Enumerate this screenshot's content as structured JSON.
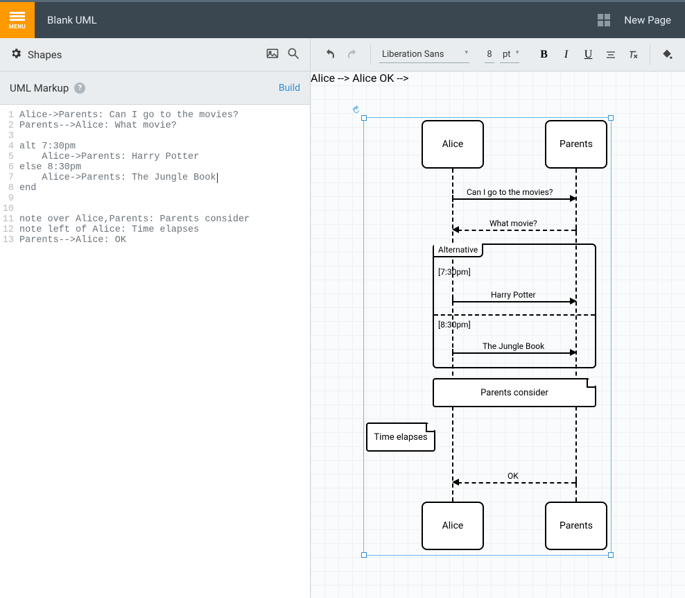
{
  "topbar": {
    "menu_label": "MENU",
    "doc_title": "Blank UML",
    "new_page": "New Page"
  },
  "toolbar": {
    "shapes_label": "Shapes",
    "font_family": "Liberation Sans",
    "font_size": "8",
    "font_unit": "pt"
  },
  "markup": {
    "title": "UML Markup",
    "build": "Build",
    "lines": [
      "Alice->Parents: Can I go to the movies?",
      "Parents-->Alice: What movie?",
      "",
      "alt 7:30pm",
      "    Alice->Parents: Harry Potter",
      "else 8:30pm",
      "    Alice->Parents: The Jungle Book",
      "end",
      "",
      "",
      "note over Alice,Parents: Parents consider",
      "note left of Alice: Time elapses",
      "Parents-->Alice: OK"
    ]
  },
  "diagram": {
    "participants": {
      "alice": "Alice",
      "parents": "Parents"
    },
    "messages": {
      "m1": "Can I go to the movies?",
      "m2": "What movie?",
      "m3": "Harry Potter",
      "m4": "The Jungle Book",
      "m5": "OK"
    },
    "alt": {
      "title": "Alternative",
      "cond1": "[7:30pm]",
      "cond2": "[8:30pm]"
    },
    "notes": {
      "n1": "Parents consider",
      "n2": "Time elapses"
    }
  }
}
